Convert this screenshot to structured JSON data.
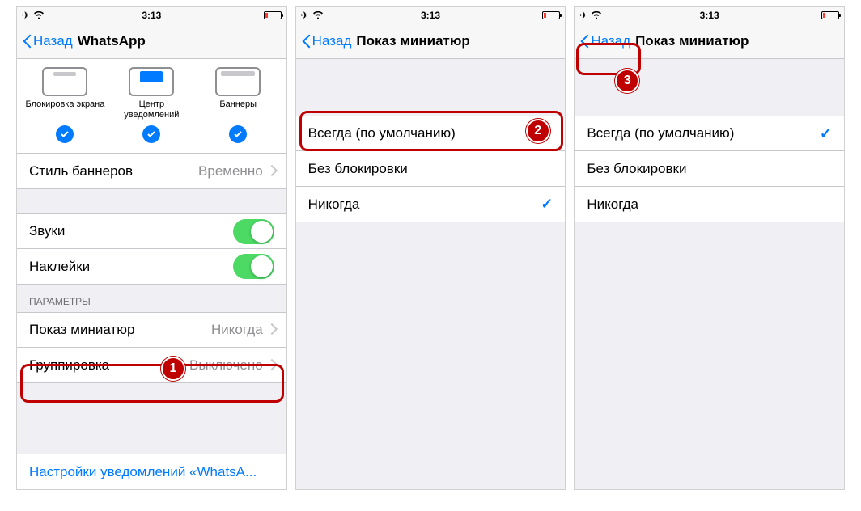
{
  "status": {
    "time": "3:13"
  },
  "phone1": {
    "back": "Назад",
    "title": "WhatsApp",
    "alerts": {
      "lock": "Блокировка экрана",
      "center": "Центр уведомлений",
      "banner": "Баннеры"
    },
    "banner_style": {
      "label": "Стиль баннеров",
      "value": "Временно"
    },
    "sounds": "Звуки",
    "stickers": "Наклейки",
    "params_header": "ПАРАМЕТРЫ",
    "previews": {
      "label": "Показ миниатюр",
      "value": "Никогда"
    },
    "grouping": {
      "label": "Группировка",
      "value": "Выключено"
    },
    "footer_link": "Настройки уведомлений «WhatsA..."
  },
  "phone2": {
    "back": "Назад",
    "title": "Показ миниатюр",
    "options": {
      "always": "Всегда (по умолчанию)",
      "unlocked": "Без блокировки",
      "never": "Никогда"
    },
    "selected": "never"
  },
  "phone3": {
    "back": "Назад",
    "title": "Показ миниатюр",
    "options": {
      "always": "Всегда (по умолчанию)",
      "unlocked": "Без блокировки",
      "never": "Никогда"
    },
    "selected": "always"
  },
  "callouts": {
    "b1": "1",
    "b2": "2",
    "b3": "3"
  }
}
